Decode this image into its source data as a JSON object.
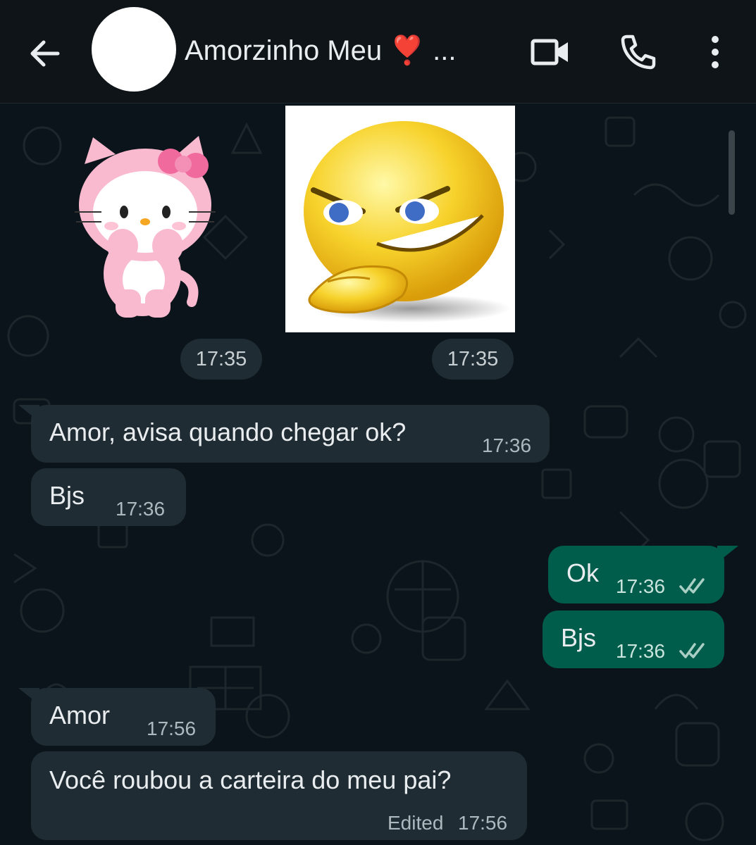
{
  "header": {
    "contact_name": "Amorzinho Meu ❣️ ...",
    "back_icon": "arrow-left-icon",
    "video_icon": "video-call-icon",
    "call_icon": "phone-icon",
    "menu_icon": "more-vertical-icon"
  },
  "colors": {
    "background": "#0b141a",
    "incoming_bubble": "#1f2c33",
    "outgoing_bubble": "#005c4b",
    "read_ticks": "#a9cfc4"
  },
  "stickers": [
    {
      "name": "hello-kitty-sticker",
      "time": "17:35"
    },
    {
      "name": "smug-smiley-sticker",
      "time": "17:35"
    }
  ],
  "messages": [
    {
      "direction": "in",
      "text": "Amor, avisa quando chegar ok?",
      "time": "17:36"
    },
    {
      "direction": "in",
      "text": "Bjs",
      "time": "17:36"
    },
    {
      "direction": "out",
      "text": "Ok",
      "time": "17:36",
      "status": "read"
    },
    {
      "direction": "out",
      "text": "Bjs",
      "time": "17:36",
      "status": "read"
    },
    {
      "direction": "in",
      "text": "Amor",
      "time": "17:56"
    },
    {
      "direction": "in",
      "text": "Você roubou a carteira do meu pai?",
      "time": "17:56",
      "edited_label": "Edited"
    }
  ]
}
